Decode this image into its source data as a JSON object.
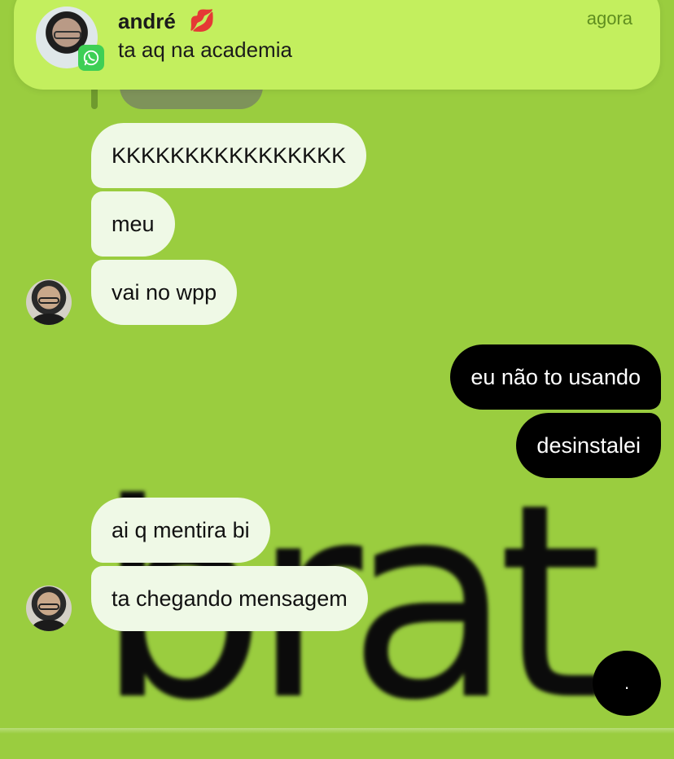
{
  "notification": {
    "sender": "andré",
    "emoji": "💋",
    "message": "ta aq na academia",
    "time": "agora",
    "app_icon": "whatsapp-icon"
  },
  "wallpaper": {
    "text": "brat"
  },
  "messages": {
    "m1": "KKKKKKKKKKKKKKKK",
    "m2": "meu",
    "m3": "vai no wpp",
    "m4": "eu não to usando",
    "m5": "desinstalei",
    "m6": "ai q mentira bi",
    "m7": "ta chegando mensagem"
  },
  "fab": {
    "label": "."
  },
  "colors": {
    "background": "#9ACD3F",
    "incoming_bubble": "#EFF9E6",
    "outgoing_bubble": "#000000",
    "notification": "#C3EF5E"
  }
}
